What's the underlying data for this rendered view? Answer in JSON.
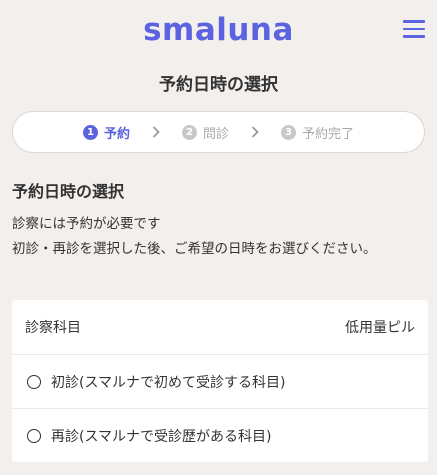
{
  "header": {
    "logo": "smaluna"
  },
  "page_title": "予約日時の選択",
  "stepper": {
    "steps": [
      {
        "num": "1",
        "label": "予約",
        "active": true
      },
      {
        "num": "2",
        "label": "問診",
        "active": false
      },
      {
        "num": "3",
        "label": "予約完了",
        "active": false
      }
    ]
  },
  "section_title": "予約日時の選択",
  "description": {
    "line1": "診察には予約が必要です",
    "line2": "初診・再診を選択した後、ご希望の日時をお選びください。"
  },
  "card": {
    "label": "診察科目",
    "value": "低用量ピル",
    "options": [
      {
        "label": "初診(スマルナで初めて受診する科目)"
      },
      {
        "label": "再診(スマルナで受診歴がある科目)"
      }
    ]
  },
  "colors": {
    "accent": "#5b63e0",
    "background": "#f3efec"
  }
}
